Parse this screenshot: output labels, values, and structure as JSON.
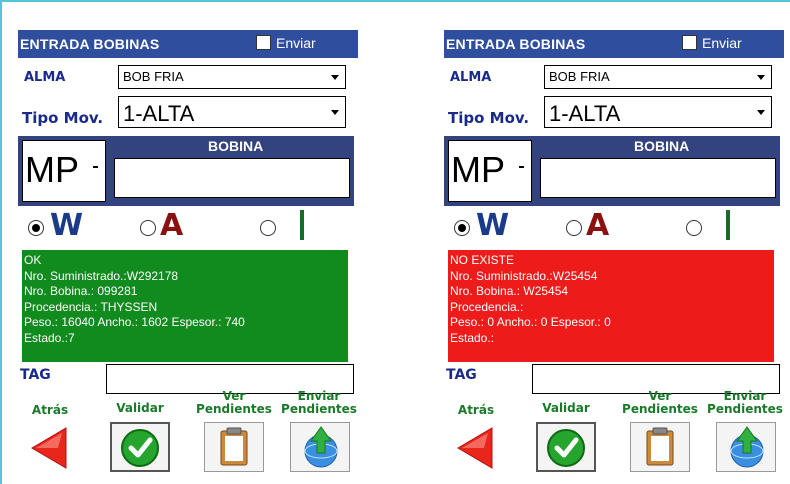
{
  "panels": [
    {
      "header": {
        "title": "ENTRADA BOBINAS",
        "check_label": "Enviar"
      },
      "alma": {
        "label": "ALMA",
        "value": "BOB FRIA"
      },
      "tipo": {
        "label": "Tipo Mov.",
        "value": "1-ALTA"
      },
      "bobina": {
        "title": "BOBINA",
        "prefix": "MP",
        "value": ""
      },
      "radios": {
        "w": "W",
        "a": "A",
        "selected": "W"
      },
      "status": {
        "color": "#118a1e",
        "lines": [
          "OK",
          "Nro. Suministrado.:W292178",
          "Nro. Bobina.: 099281",
          "Procedencia.: THYSSEN",
          "Peso.: 16040 Ancho.: 1602 Espesor.: 740",
          "Estado.:7"
        ]
      },
      "tag": {
        "label": "TAG",
        "value": ""
      },
      "buttons": {
        "back": "Atrás",
        "validate": "Validar",
        "pending": "Ver Pendientes",
        "send": "Enviar Pendientes"
      }
    },
    {
      "header": {
        "title": "ENTRADA BOBINAS",
        "check_label": "Enviar"
      },
      "alma": {
        "label": "ALMA",
        "value": "BOB FRIA"
      },
      "tipo": {
        "label": "Tipo Mov.",
        "value": "1-ALTA"
      },
      "bobina": {
        "title": "BOBINA",
        "prefix": "MP",
        "value": ""
      },
      "radios": {
        "w": "W",
        "a": "A",
        "selected": "W"
      },
      "status": {
        "color": "#ee1b1b",
        "lines": [
          "NO EXISTE",
          "Nro. Suministrado.:W25454",
          "Nro. Bobina.: W25454",
          "Procedencia.:",
          "Peso.: 0 Ancho.: 0 Espesor.: 0",
          "Estado.:"
        ]
      },
      "tag": {
        "label": "TAG",
        "value": ""
      },
      "buttons": {
        "back": "Atrás",
        "validate": "Validar",
        "pending": "Ver Pendientes",
        "send": "Enviar Pendientes"
      }
    }
  ]
}
